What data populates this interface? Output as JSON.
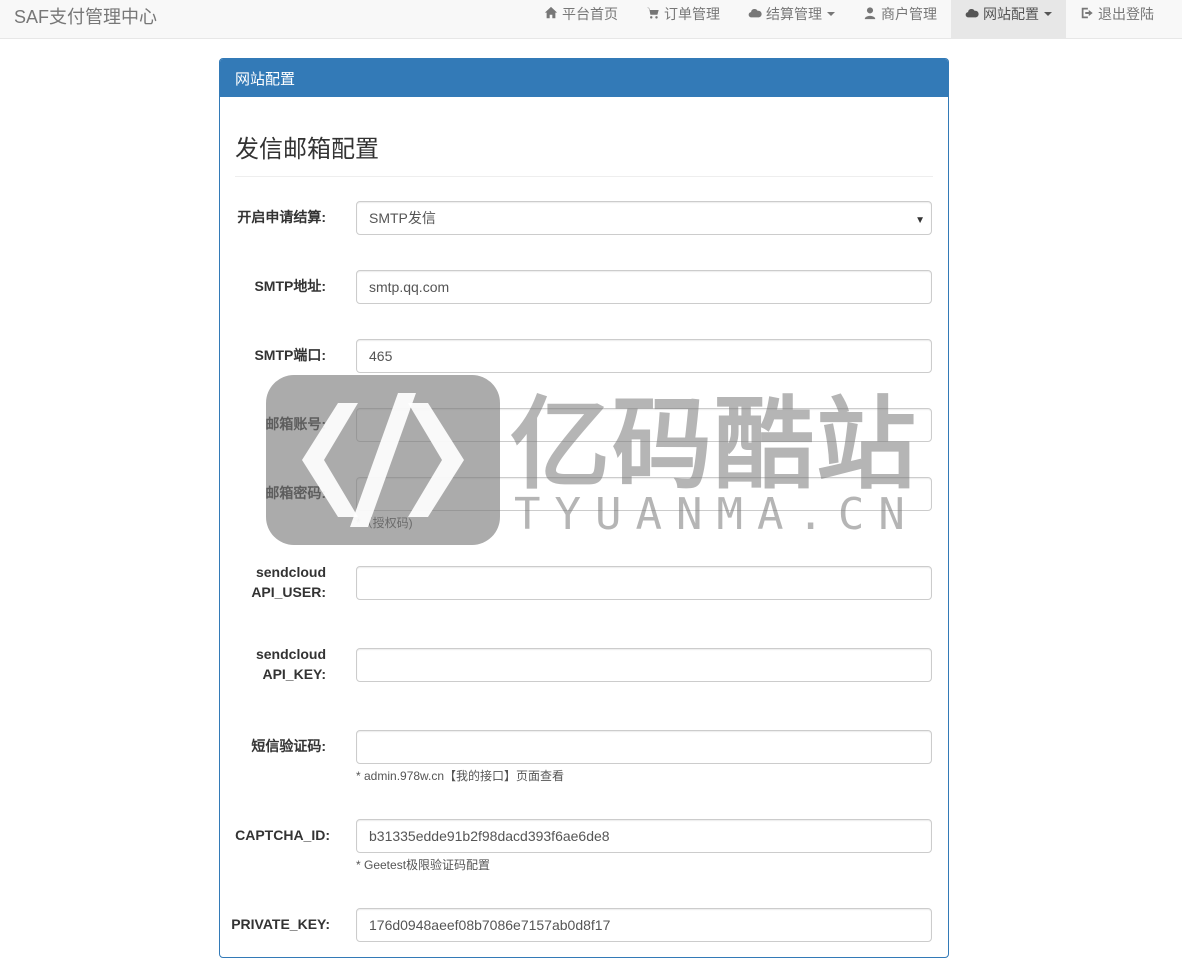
{
  "navbar": {
    "brand": "SAF支付管理中心",
    "items": [
      {
        "label": "平台首页",
        "icon": "home-icon"
      },
      {
        "label": "订单管理",
        "icon": "cart-icon"
      },
      {
        "label": "结算管理",
        "icon": "cloud-icon"
      },
      {
        "label": "商户管理",
        "icon": "user-icon"
      },
      {
        "label": "网站配置",
        "icon": "cloud-icon"
      },
      {
        "label": "退出登陆",
        "icon": "logout-icon"
      }
    ]
  },
  "panel": {
    "heading": "网站配置",
    "section_title": "发信邮箱配置"
  },
  "form": {
    "mail_mode": {
      "label": "开启申请结算:",
      "value": "SMTP发信"
    },
    "smtp_host": {
      "label": "SMTP地址:",
      "value": "smtp.qq.com"
    },
    "smtp_port": {
      "label": "SMTP端口:",
      "value": "465"
    },
    "mail_account": {
      "label": "邮箱账号:",
      "value": ""
    },
    "mail_password": {
      "label": "邮箱密码:",
      "value": "",
      "help": "*（授权码)"
    },
    "sendcloud_user": {
      "label_line1": "sendcloud",
      "label_line2": "API_USER:",
      "value": ""
    },
    "sendcloud_key": {
      "label_line1": "sendcloud",
      "label_line2": "API_KEY:",
      "value": ""
    },
    "sms_code": {
      "label": "短信验证码:",
      "value": "",
      "help": "* admin.978w.cn【我的接口】页面查看"
    },
    "captcha_id": {
      "label": "CAPTCHA_ID:",
      "value": "b31335edde91b2f98dacd393f6ae6de8",
      "help": "* Geetest极限验证码配置"
    },
    "private_key": {
      "label": "PRIVATE_KEY:",
      "value": "176d0948aeef08b7086e7157ab0d8f17"
    }
  },
  "watermark": {
    "title": "亿码酷站",
    "subtitle": "TYUANMA.CN"
  },
  "colors": {
    "primary": "#337ab7",
    "navbar_bg": "#f8f8f8",
    "nav_text": "#777777"
  }
}
